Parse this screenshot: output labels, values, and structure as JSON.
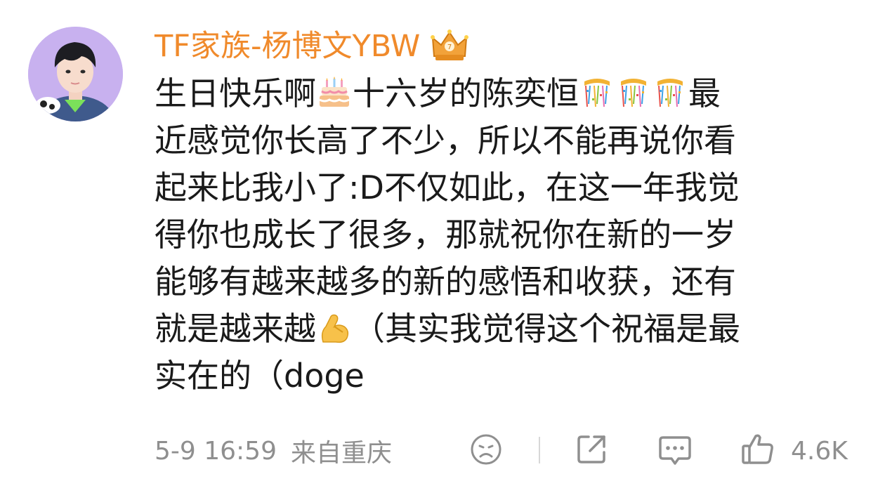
{
  "comment": {
    "username": "TF家族-杨博文YBW",
    "badge_icon": "crown-badge-icon",
    "lines": [
      {
        "a": "生日快乐啊",
        "e1": "birthday-cake-emoji",
        "b": "十六岁的陈奕恒",
        "e2": "party-popper-emoji",
        "c": "最"
      },
      {
        "a": "近感觉你长高了不少，所以不能再说你看"
      },
      {
        "a": "起来比我小了:D不仅如此，在这一年我觉"
      },
      {
        "a": "得你也成长了很多，那就祝你在新的一岁"
      },
      {
        "a": "能够有越来越多的新的感悟和收获，还有"
      },
      {
        "a": "就是越来越",
        "e1": "flexed-biceps-emoji",
        "b": "（其实我觉得这个祝福是最"
      },
      {
        "a": "实在的（doge"
      }
    ]
  },
  "meta": {
    "time": "5-9 16:59",
    "location": "来自重庆"
  },
  "actions": {
    "react_icon": "frown-face-icon",
    "share_icon": "share-icon",
    "comment_icon": "comment-bubble-icon",
    "like_icon": "thumbs-up-icon",
    "like_count": "4.6K"
  },
  "colors": {
    "username": "#f08a2b",
    "text": "#1a1a1a",
    "meta": "#8f8f8f"
  }
}
